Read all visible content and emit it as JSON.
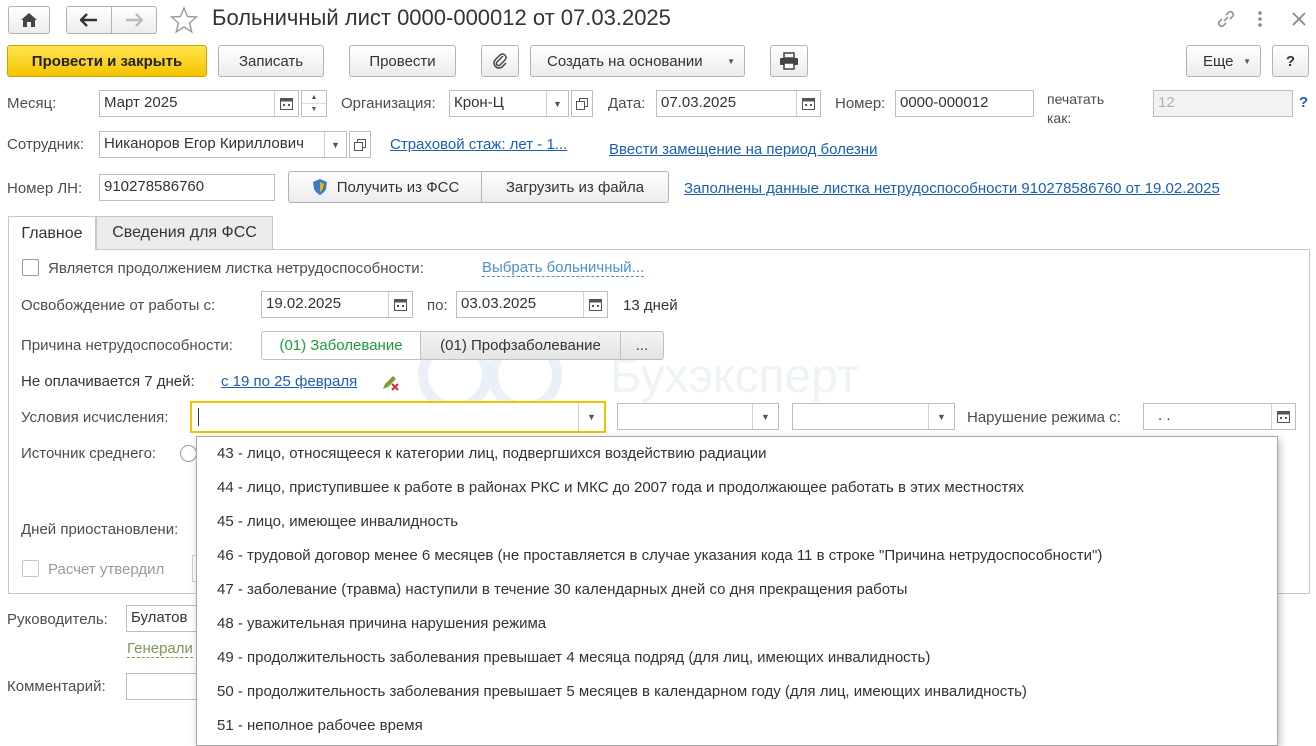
{
  "window": {
    "title": "Больничный лист 0000-000012 от 07.03.2025"
  },
  "toolbar": {
    "post_close": "Провести и закрыть",
    "save": "Записать",
    "post": "Провести",
    "create_based": "Создать на основании",
    "more": "Еще",
    "help": "?"
  },
  "header": {
    "month_label": "Месяц:",
    "month_value": "Март 2025",
    "org_label": "Организация:",
    "org_value": "Крон-Ц",
    "date_label": "Дата:",
    "date_value": "07.03.2025",
    "number_label": "Номер:",
    "number_value": "0000-000012",
    "print_as_line1": "печатать",
    "print_as_line2": "как:",
    "print_as_value": "12",
    "help_q": "?",
    "employee_label": "Сотрудник:",
    "employee_value": "Никаноров Егор Кириллович",
    "insurance_link": "Страховой стаж: лет - 1...",
    "replacement_link": "Ввести замещение на период болезни",
    "ln_label": "Номер ЛН:",
    "ln_value": "910278586760",
    "get_fss": "Получить из ФСС",
    "load_file": "Загрузить из файла",
    "filled_link": "Заполнены данные листка нетрудоспособности 910278586760 от 19.02.2025"
  },
  "tabs": [
    {
      "label": "Главное"
    },
    {
      "label": "Сведения для ФСС"
    }
  ],
  "main": {
    "continuation_label": "Является продолжением листка нетрудоспособности:",
    "choose_sick_link": "Выбрать больничный...",
    "release_label": "Освобождение от работы с:",
    "release_from": "19.02.2025",
    "to_label": "по:",
    "release_to": "03.03.2025",
    "days": "13 дней",
    "reason_label": "Причина нетрудоспособности:",
    "reason_disease": "(01) Заболевание",
    "reason_occupational": "(01) Профзаболевание",
    "reason_more": "...",
    "not_paid_label": "Не оплачивается 7 дней:",
    "not_paid_link": "с 19 по 25 февраля",
    "conditions_label": "Условия исчисления:",
    "conditions_value": "",
    "violation_label": "Нарушение режима с:",
    "violation_value": ".  .",
    "source_label": "Источник среднего:",
    "suspension_label": "Дней приостановлени:",
    "approved_label": "Расчет утвердил"
  },
  "footer": {
    "manager_label": "Руководитель:",
    "manager_value": "Булатов",
    "manager_position": "Генерали",
    "comment_label": "Комментарий:"
  },
  "dropdown_items": [
    "43 - лицо, относящееся к категории лиц, подвергшихся воздействию радиации",
    "44 - лицо, приступившее к работе в районах РКС и МКС до 2007 года и продолжающее работать в этих местностях",
    "45 - лицо, имеющее инвалидность",
    "46 - трудовой договор менее 6 месяцев (не проставляется в случае указания кода 11 в строке \"Причина нетрудоспособности\")",
    "47 - заболевание (травма) наступили в течение 30 календарных дней со дня прекращения работы",
    "48 - уважительная причина нарушения режима",
    "49 - продолжительность заболевания превышает 4 месяца подряд (для лиц, имеющих инвалидность)",
    "50 - продолжительность заболевания превышает 5 месяцев в календарном году (для лиц, имеющих инвалидность)",
    "51 - неполное рабочее время"
  ],
  "watermark": {
    "text": "Бухэксперт"
  },
  "colors": {
    "accent_yellow": "#f5c400",
    "link_blue": "#1a5fb4",
    "active_green": "#1e9b3a"
  }
}
